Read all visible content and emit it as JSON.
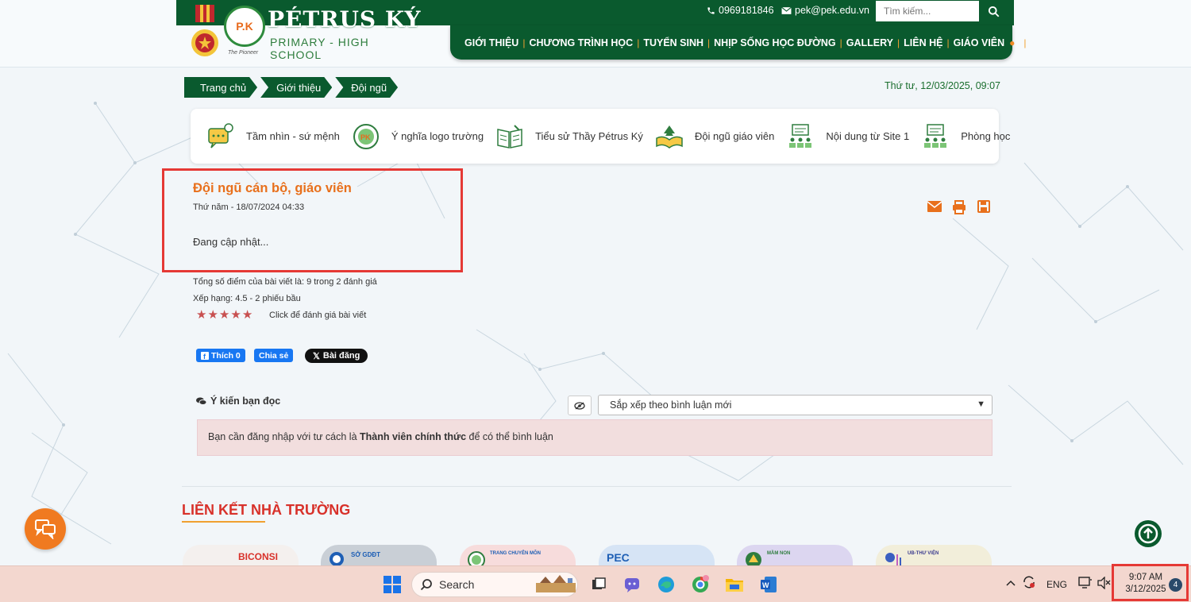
{
  "header": {
    "brand_name": "PÉTRUS KÝ",
    "brand_sub": "PRIMARY - HIGH SCHOOL",
    "brand_tagline": "The Pioneer",
    "logo_text": "P.K",
    "phone": "0969181846",
    "email": "pek@pek.edu.vn",
    "search_placeholder": "Tìm kiếm...",
    "nav": [
      "GIỚI THIỆU",
      "CHƯƠNG TRÌNH HỌC",
      "TUYỂN SINH",
      "NHỊP SỐNG HỌC ĐƯỜNG",
      "GALLERY",
      "LIÊN HỆ",
      "GIÁO VIÊN"
    ]
  },
  "breadcrumb": [
    "Trang chủ",
    "Giới thiệu",
    "Đội ngũ"
  ],
  "datetime": "Thứ tư, 12/03/2025, 09:07",
  "subnav": [
    {
      "label": "Tầm nhìn - sứ mệnh",
      "icon": "vision-chat-icon"
    },
    {
      "label": "Ý nghĩa logo trường",
      "icon": "school-logo-icon"
    },
    {
      "label": "Tiểu sử Thầy Pétrus Ký",
      "icon": "book-icon"
    },
    {
      "label": "Đội ngũ giáo viên",
      "icon": "open-book-tree-icon"
    },
    {
      "label": "Nội dung từ Site 1",
      "icon": "classroom-icon"
    },
    {
      "label": "Phòng học",
      "icon": "classroom-icon"
    }
  ],
  "article": {
    "title": "Đội ngũ cán bộ, giáo viên",
    "date": "Thứ năm - 18/07/2024 04:33",
    "body": "Đang cập nhật..."
  },
  "rating": {
    "total": "Tổng số điểm của bài viết là: 9 trong 2 đánh giá",
    "rank": "Xếp hạng: 4.5 - 2 phiếu bầu",
    "value": 4.5,
    "max": 5,
    "click_label": "Click để đánh giá bài viết"
  },
  "share": {
    "like": "Thích 0",
    "share": "Chia sẻ",
    "post": "Bài đăng"
  },
  "comments": {
    "heading": "Ý kiến bạn đọc",
    "sort_selected": "Sắp xếp theo bình luận mới",
    "notice_prefix": "Bạn cần đăng nhập với tư cách là ",
    "notice_bold": "Thành viên chính thức",
    "notice_suffix": " để có thể bình luận"
  },
  "links": {
    "title": "LIÊN KẾT NHÀ TRƯỜNG",
    "partners": [
      "BICONSI",
      "SỞ GDĐT",
      "TRANG CHUYÊN MÔN",
      "PEC",
      "MẦM NON",
      "UB-THƯ VIỆN"
    ]
  },
  "taskbar": {
    "search_label": "Search",
    "lang": "ENG",
    "time": "9:07 AM",
    "date": "3/12/2025",
    "notifications": "4"
  },
  "colors": {
    "brand_green": "#0a5a2e",
    "accent_orange": "#e8701c",
    "alert_red": "#e53935"
  }
}
